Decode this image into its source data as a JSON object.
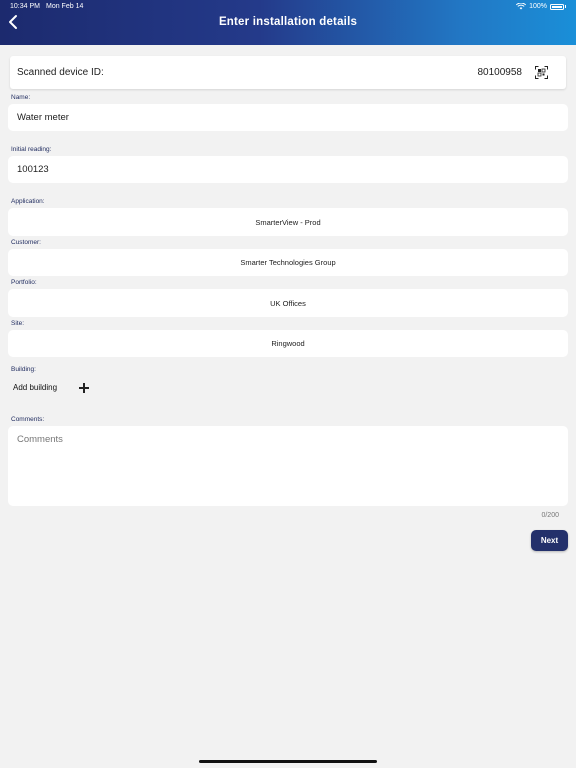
{
  "status_bar": {
    "time": "10:34 PM",
    "date": "Mon Feb 14",
    "battery": "100%",
    "icons": [
      "wifi-icon",
      "battery-icon"
    ]
  },
  "header": {
    "title": "Enter installation details",
    "back_icon": "chevron-left-icon"
  },
  "device": {
    "label": "Scanned device ID:",
    "id": "80100958",
    "scan_icon": "qr-scan-icon"
  },
  "form": {
    "name": {
      "label": "Name:",
      "value": "Water meter"
    },
    "initial_reading": {
      "label": "Initial reading:",
      "value": "100123"
    },
    "application": {
      "label": "Application:",
      "value": "SmarterView - Prod"
    },
    "customer": {
      "label": "Customer:",
      "value": "Smarter Technologies Group"
    },
    "portfolio": {
      "label": "Portfolio:",
      "value": "UK Offices"
    },
    "site": {
      "label": "Site:",
      "value": "Ringwood"
    },
    "building": {
      "label": "Building:",
      "add_label": "Add building",
      "add_icon": "plus-icon"
    },
    "comments": {
      "label": "Comments:",
      "placeholder": "Comments",
      "value": "",
      "counter": "0/200"
    }
  },
  "actions": {
    "next_label": "Next"
  },
  "colors": {
    "header_gradient_start": "#1c2a6e",
    "header_gradient_end": "#1a8fd8",
    "accent": "#23306b",
    "label": "#1e2a5e",
    "background": "#f2f2f2"
  }
}
